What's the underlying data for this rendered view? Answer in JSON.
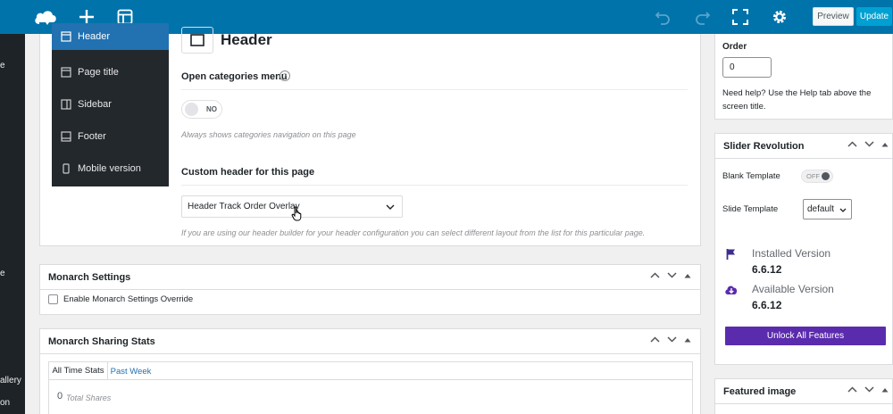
{
  "admin_side": {
    "snippets": [
      "e",
      "e",
      "allery",
      "on"
    ]
  },
  "toolbar": {
    "logo_icon": "cloud-logo-icon",
    "add_icon": "plus-icon",
    "layout_icon": "layout-icon",
    "undo_icon": "undo-icon",
    "redo_icon": "redo-icon",
    "fullscreen_icon": "fullscreen-icon",
    "settings_icon": "gear-icon",
    "preview_label": "Preview",
    "update_label": "Update"
  },
  "header_panel": {
    "nav": [
      {
        "label": "Header",
        "icon": "window-icon",
        "active": true
      },
      {
        "label": "Page title",
        "icon": "window-icon",
        "active": false
      },
      {
        "label": "Sidebar",
        "icon": "sidebar-icon",
        "active": false
      },
      {
        "label": "Footer",
        "icon": "footer-icon",
        "active": false
      },
      {
        "label": "Mobile version",
        "icon": "mobile-icon",
        "active": false
      }
    ],
    "title": "Header",
    "open_categories_label": "Open categories menu",
    "toggle_value": "NO",
    "toggle_help": "Always shows categories navigation on this page",
    "custom_header_label": "Custom header for this page",
    "custom_header_value": "Header Track Order Overlay",
    "custom_header_help": "If you are using our header builder for your header configuration you can select different layout from the list for this particular page."
  },
  "monarch_settings": {
    "title": "Monarch Settings",
    "checkbox_label": "Enable Monarch Settings Override",
    "checked": false
  },
  "monarch_stats": {
    "title": "Monarch Sharing Stats",
    "tabs": [
      "All Time Stats",
      "Past Week"
    ],
    "active_tab": "All Time Stats",
    "total_count": "0",
    "total_label": "Total Shares"
  },
  "page_attributes": {
    "order_label": "Order",
    "order_value": "0",
    "help_text": "Need help? Use the Help tab above the screen title."
  },
  "slider_revolution": {
    "title": "Slider Revolution",
    "blank_template_label": "Blank Template",
    "blank_toggle": "OFF",
    "slide_template_label": "Slide Template",
    "slide_template_value": "default",
    "installed_label": "Installed Version",
    "installed_version": "6.6.12",
    "available_label": "Available Version",
    "available_version": "6.6.12",
    "unlock_label": "Unlock All Features",
    "accent": "#5b2bae"
  },
  "featured_image": {
    "title": "Featured image"
  }
}
